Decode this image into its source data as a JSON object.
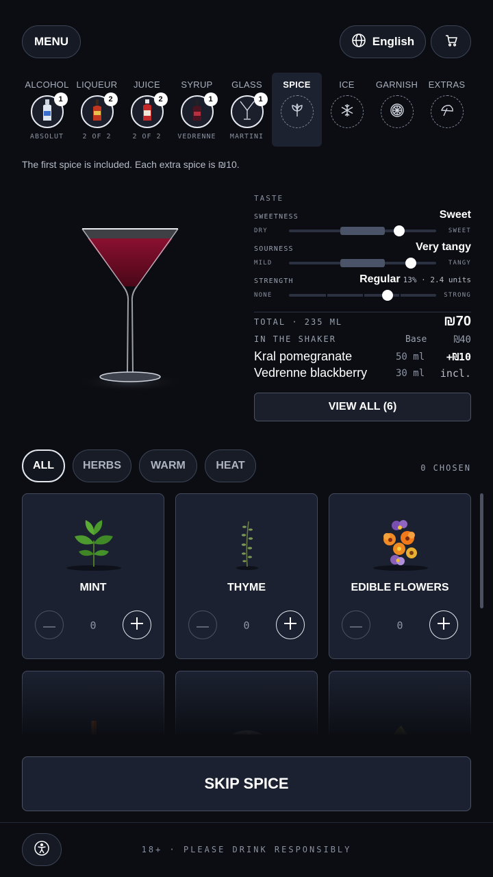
{
  "header": {
    "menu_label": "MENU",
    "language_label": "English"
  },
  "steps": [
    {
      "label": "ALCOHOL",
      "badge": "1",
      "sub": "ABSOLUT"
    },
    {
      "label": "LIQUEUR",
      "badge": "2",
      "sub": "2 OF 2"
    },
    {
      "label": "JUICE",
      "badge": "2",
      "sub": "2 OF 2"
    },
    {
      "label": "SYRUP",
      "badge": "1",
      "sub": "VEDRENNE"
    },
    {
      "label": "GLASS",
      "badge": "1",
      "sub": "MARTINI"
    },
    {
      "label": "SPICE",
      "icon": "leaf-icon"
    },
    {
      "label": "ICE",
      "icon": "snowflake-icon"
    },
    {
      "label": "GARNISH",
      "icon": "citrus-slice-icon"
    },
    {
      "label": "EXTRAS",
      "icon": "umbrella-icon"
    }
  ],
  "notice": "The first spice is included. Each extra spice is ₪10.",
  "taste": {
    "caption": "TASTE",
    "sweetness": {
      "name": "SWEETNESS",
      "value": "Sweet",
      "left": "DRY",
      "right": "SWEET",
      "level": 0.75
    },
    "sourness": {
      "name": "SOURNESS",
      "value": "Very tangy",
      "left": "MILD",
      "right": "TANGY",
      "level": 0.83
    },
    "strength": {
      "name": "STRENGTH",
      "value": "Regular",
      "extra": "13% · 2.4 units",
      "left": "NONE",
      "right": "STRONG",
      "level": 0.67
    }
  },
  "summary": {
    "total_label": "TOTAL · 235 ML",
    "total_price": "₪70",
    "shaker_label": "IN THE SHAKER",
    "base_label": "Base",
    "base_price": "₪40",
    "items": [
      {
        "name": "Kral pomegranate",
        "amount": "50 ml",
        "price": "+₪10"
      },
      {
        "name": "Vedrenne blackberry",
        "amount": "30 ml",
        "price": "incl."
      }
    ],
    "view_all": "VIEW ALL (6)"
  },
  "filters": {
    "items": [
      "ALL",
      "HERBS",
      "WARM",
      "HEAT"
    ],
    "chosen": "0 CHOSEN"
  },
  "cards": [
    {
      "name": "MINT",
      "qty": "0"
    },
    {
      "name": "THYME",
      "qty": "0"
    },
    {
      "name": "EDIBLE FLOWERS",
      "qty": "0"
    },
    {
      "name": "",
      "qty": ""
    },
    {
      "name": "",
      "qty": ""
    },
    {
      "name": "",
      "qty": ""
    }
  ],
  "skip_label": "SKIP SPICE",
  "footer": "18+ · PLEASE DRINK RESPONSIBLY"
}
